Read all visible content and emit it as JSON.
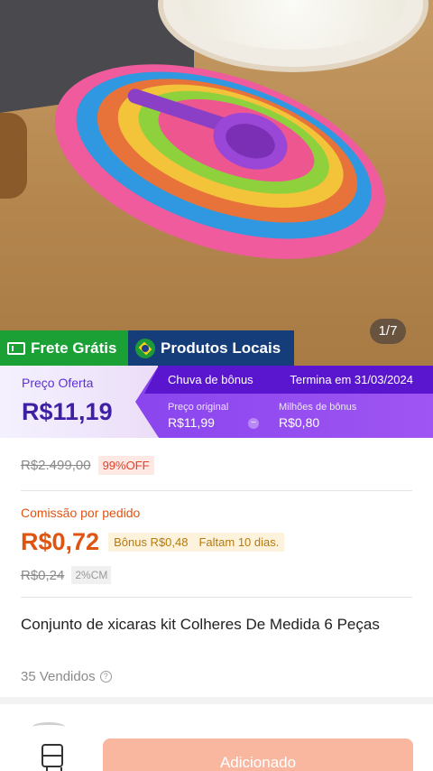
{
  "gallery": {
    "counter": "1/7"
  },
  "ribbon": {
    "free_shipping": "Frete Grátis",
    "local_products": "Produtos Locais"
  },
  "price": {
    "offer_label": "Preço Oferta",
    "offer_value": "R$11,19",
    "bonus_rain": "Chuva de bônus",
    "ends": "Termina em 31/03/2024",
    "original_label": "Preço original",
    "original_value": "R$11,99",
    "bonus_millions_label": "Milhões de bônus",
    "bonus_millions_value": "R$0,80",
    "minus_symbol": "−"
  },
  "discount": {
    "old_price": "R$2.499,00",
    "off_badge": "99%OFF"
  },
  "commission": {
    "label": "Comissão por pedido",
    "value": "R$0,72",
    "bonus": "Bônus R$0,48",
    "remaining": "Faltam 10 dias.",
    "old_value": "R$0,24",
    "cm_badge": "2%CM"
  },
  "product": {
    "title": "Conjunto de xicaras kit Colheres De Medida 6 Peças",
    "sold": "35 Vendidos",
    "help_symbol": "?"
  },
  "bottom_bar": {
    "add_button": "Adicionado"
  },
  "colors": {
    "green": "#1aa035",
    "navy": "#143d7a",
    "purple": "#5a15cf",
    "orange": "#e05412",
    "button": "#f9b79f"
  }
}
